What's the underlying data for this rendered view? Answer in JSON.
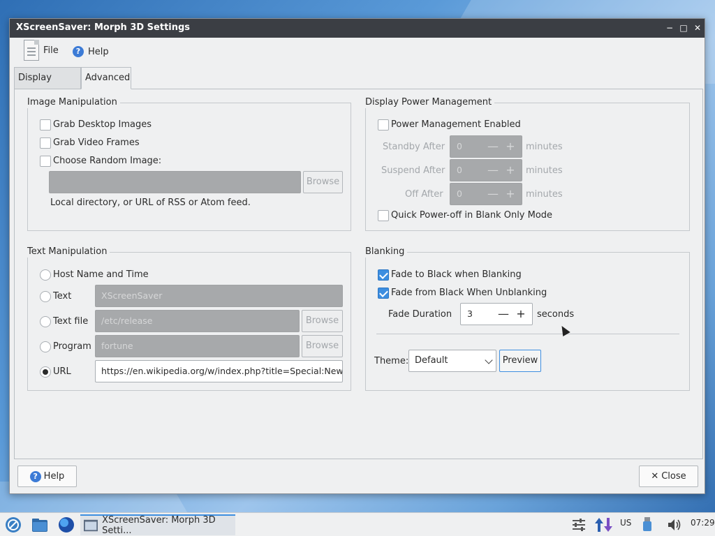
{
  "window": {
    "title": "XScreenSaver: Morph 3D Settings",
    "controls": [
      "−",
      "□",
      "✕"
    ]
  },
  "menu": {
    "file": "File",
    "help": "Help"
  },
  "tabs": [
    "Display Modes",
    "Advanced"
  ],
  "image_manipulation": {
    "title": "Image Manipulation",
    "grab_desktop": "Grab Desktop Images",
    "grab_video": "Grab Video Frames",
    "choose_random": "Choose Random Image:",
    "path_value": "",
    "browse": "Browse",
    "hint": "Local directory, or URL of RSS or Atom feed."
  },
  "power": {
    "title": "Display Power Management",
    "enabled": "Power Management Enabled",
    "standby": {
      "label": "Standby After",
      "value": "0"
    },
    "suspend": {
      "label": "Suspend After",
      "value": "0"
    },
    "off": {
      "label": "Off After",
      "value": "0"
    },
    "unit": "minutes",
    "quick_off": "Quick Power-off in Blank Only Mode",
    "minus": "—",
    "plus": "+"
  },
  "text_manipulation": {
    "title": "Text Manipulation",
    "host": "Host Name and Time",
    "text": {
      "label": "Text",
      "value": "XScreenSaver"
    },
    "file": {
      "label": "Text file",
      "value": "/etc/release"
    },
    "program": {
      "label": "Program",
      "value": "fortune"
    },
    "url": {
      "label": "URL",
      "value": "https://en.wikipedia.org/w/index.php?title=Special:NewP"
    },
    "browse": "Browse"
  },
  "blanking": {
    "title": "Blanking",
    "fade_to": "Fade to Black when Blanking",
    "fade_from": "Fade from Black When Unblanking",
    "duration_label": "Fade Duration",
    "duration_value": "3",
    "duration_unit": "seconds",
    "theme_label": "Theme:",
    "theme_value": "Default",
    "preview": "Preview",
    "minus": "—",
    "plus": "+"
  },
  "footer": {
    "help": "Help",
    "close": "Close",
    "close_glyph": "✕"
  },
  "taskbar": {
    "task_title": "XScreenSaver: Morph 3D Setti...",
    "layout": "US",
    "time": "07:29"
  }
}
